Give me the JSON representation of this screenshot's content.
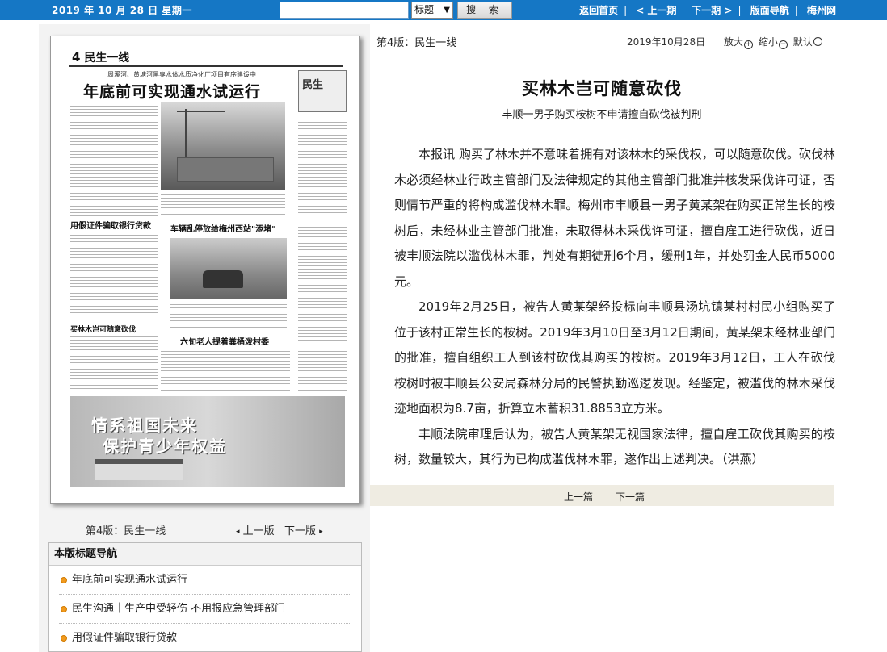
{
  "topbar": {
    "date": "2019 年 10 月 28 日 星期一",
    "search_placeholder": "",
    "search_type": "标题",
    "search_button": "搜 索",
    "nav": [
      "返回首页",
      "< 上一期",
      "下一期 >",
      "版面导航",
      "梅州网"
    ]
  },
  "paper_image": {
    "page_label": "4",
    "section": "民生一线",
    "subheadline": "周溪河、黄塘河黑臭水体水质净化厂项目有序建设中",
    "headline": "年底前可实现通水试运行",
    "sidebox": "民生",
    "h_loan": "用假证件骗取银行贷款",
    "h_cars": "车辆乱停放给梅州西站\"添堵\"",
    "h_tree": "买林木岂可随意砍伐",
    "h_elder": "六旬老人提着粪桶泼村委",
    "banner_line1": "情系祖国未来",
    "banner_line2": "保护青少年权益"
  },
  "pagebar": {
    "label": "第4版：民生一线",
    "prev": "上一版",
    "next": "下一版"
  },
  "navbox": {
    "title": "本版标题导航",
    "items": [
      "年底前可实现通水试运行",
      "民生沟通｜生产中受轻伤 不用报应急管理部门",
      "用假证件骗取银行贷款"
    ]
  },
  "article_bar": {
    "edition": "第4版：民生一线",
    "date": "2019年10月28日",
    "zoom_in": "放大",
    "zoom_out": "缩小",
    "default": "默认"
  },
  "article": {
    "title": "买林木岂可随意砍伐",
    "subtitle": "丰顺一男子购买桉树不申请擅自砍伐被判刑",
    "paragraphs": [
      "本报讯 购买了林木并不意味着拥有对该林木的采伐权，可以随意砍伐。砍伐林木必须经林业行政主管部门及法律规定的其他主管部门批准并核发采伐许可证，否则情节严重的将构成滥伐林木罪。梅州市丰顺县一男子黄某架在购买正常生长的桉树后，未经林业主管部门批准，未取得林木采伐许可证，擅自雇工进行砍伐，近日被丰顺法院以滥伐林木罪，判处有期徒刑6个月，缓刑1年，并处罚金人民币5000元。",
      "2019年2月25日，被告人黄某架经投标向丰顺县汤坑镇某村村民小组购买了位于该村正常生长的桉树。2019年3月10日至3月12日期间，黄某架未经林业部门的批准，擅自组织工人到该村砍伐其购买的桉树。2019年3月12日，工人在砍伐桉树时被丰顺县公安局森林分局的民警执勤巡逻发现。经鉴定，被滥伐的林木采伐迹地面积为8.7亩，折算立木蓄积31.8853立方米。",
      "丰顺法院审理后认为，被告人黄某架无视国家法律，擅自雇工砍伐其购买的桉树，数量较大，其行为已构成滥伐林木罪，遂作出上述判决。（洪燕）"
    ]
  },
  "footnav": {
    "prev": "上一篇",
    "next": "下一篇"
  },
  "colors": {
    "topbar": "#1577c5",
    "bullet": "#f19a1d",
    "footnav_bg": "#efece2"
  }
}
